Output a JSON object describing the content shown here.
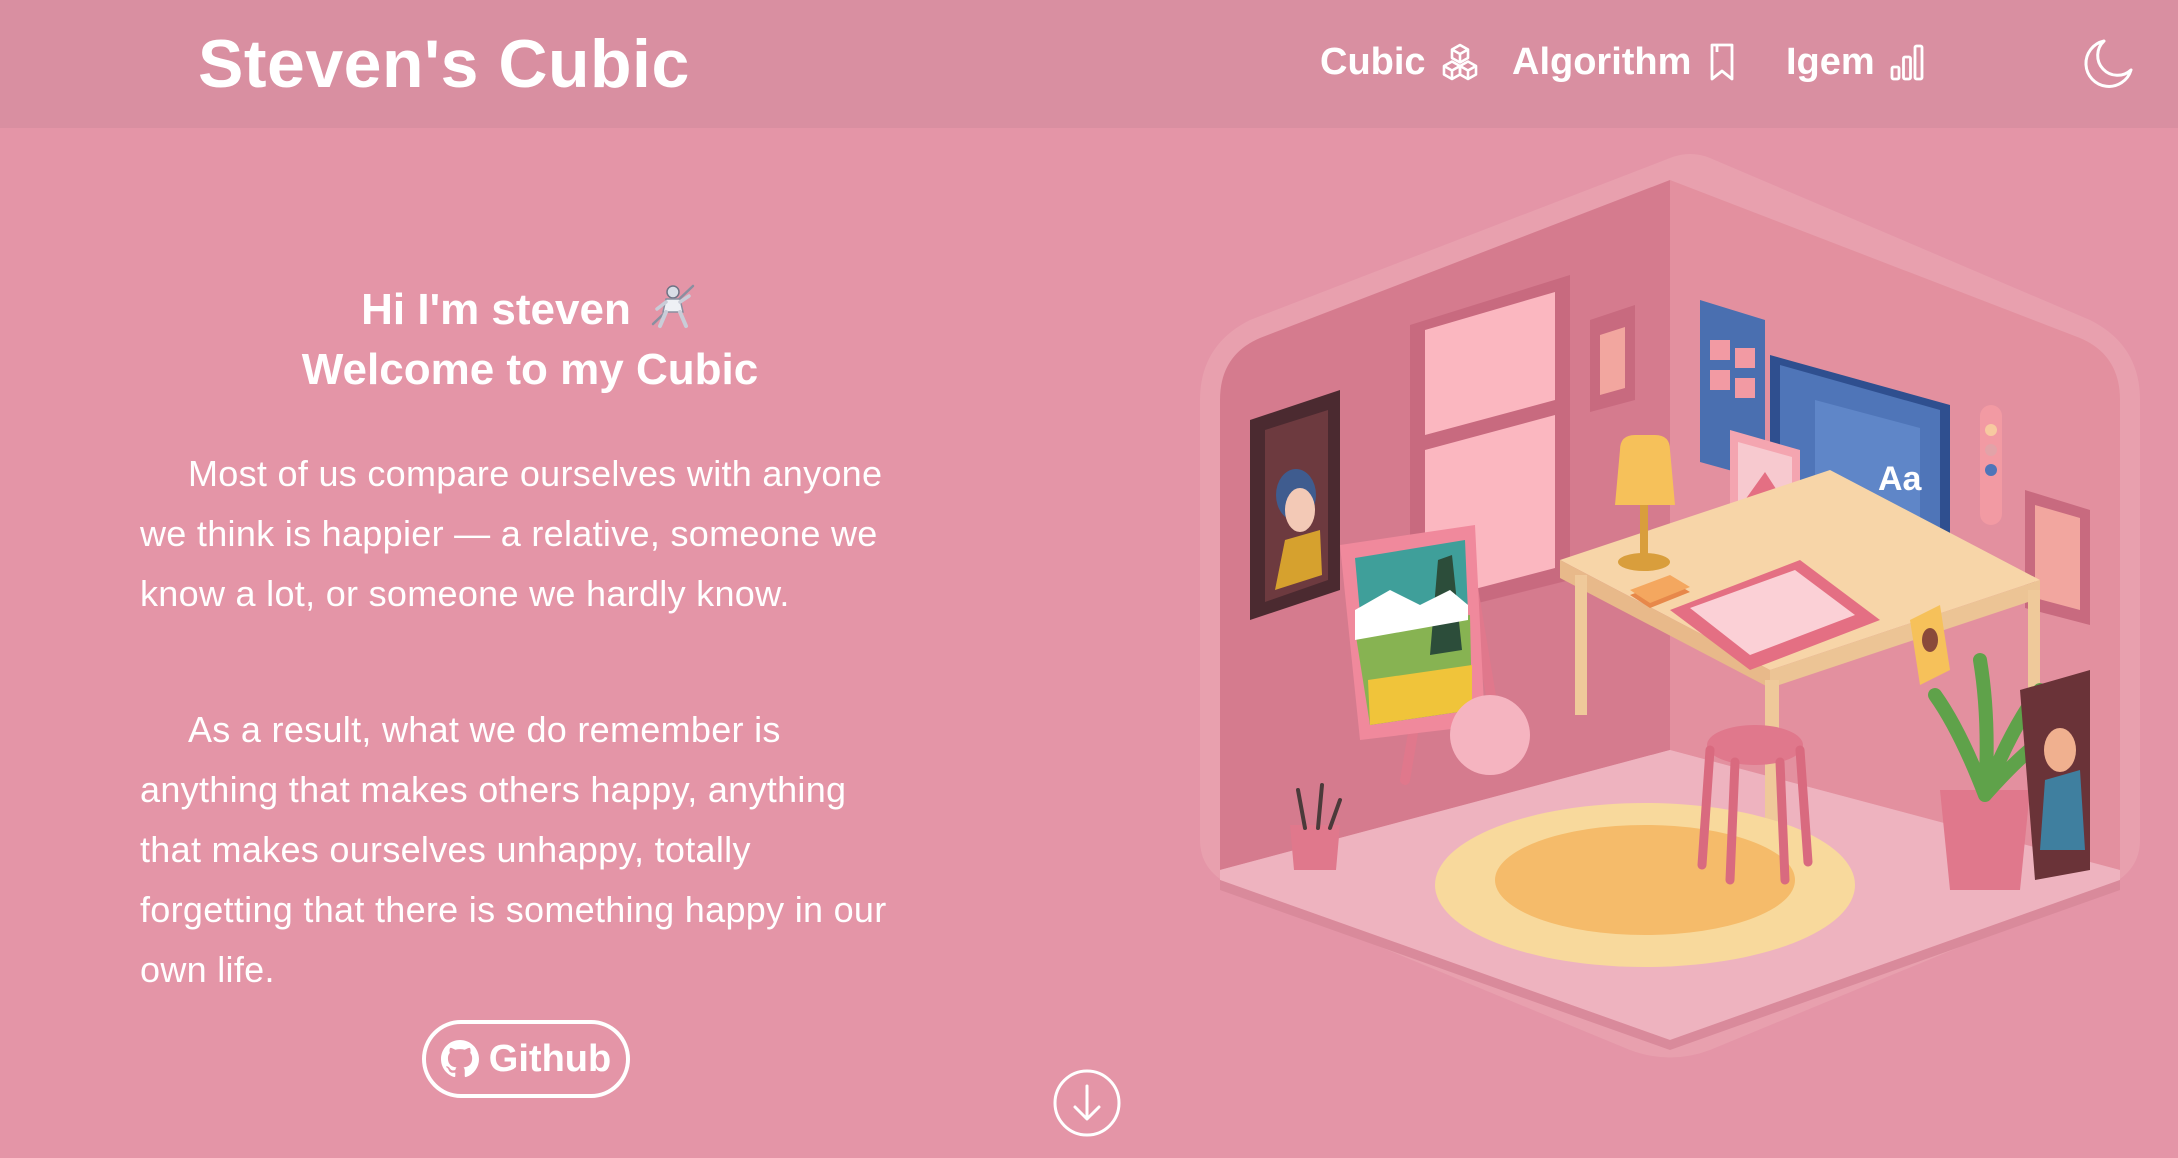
{
  "header": {
    "brand": "Steven's Cubic",
    "nav": [
      {
        "label": "Cubic",
        "icon": "cubes-icon"
      },
      {
        "label": "Algorithm",
        "icon": "bookmark-icon"
      },
      {
        "label": "Igem",
        "icon": "signal-bars-icon"
      }
    ],
    "theme_icon": "moon-icon"
  },
  "intro": {
    "greeting_line1": "Hi I'm steven",
    "greeting_emoji_icon": "fencer-icon",
    "greeting_line2": "Welcome to my Cubic",
    "paragraphs": [
      "Most of us compare ourselves with anyone we think is happier — a relative, someone we know a lot, or someone we hardly know.",
      "As a result, what we do remember is anything that makes others happy, anything that makes ourselves unhappy, totally forgetting that there is something happy in our own life."
    ],
    "github_label": "Github",
    "github_icon": "github-icon",
    "scroll_icon": "arrow-down-circle-icon"
  },
  "illustration": {
    "name": "isometric-room-illustration",
    "canvas_text": "Aa"
  },
  "colors": {
    "background": "#e495a7",
    "header": "#d98fa1",
    "text": "#ffffff"
  }
}
